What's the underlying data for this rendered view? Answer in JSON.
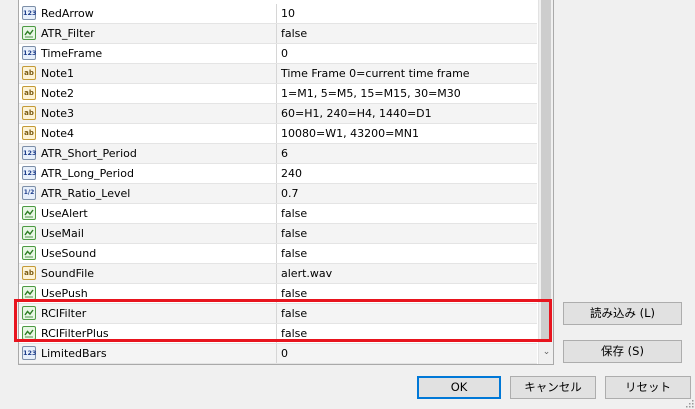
{
  "params": [
    {
      "type": "int",
      "icon": "int-type-icon",
      "name": "RedArrow",
      "value": "10"
    },
    {
      "type": "bool",
      "icon": "bool-type-icon",
      "name": "ATR_Filter",
      "value": "false"
    },
    {
      "type": "int",
      "icon": "int-type-icon",
      "name": "TimeFrame",
      "value": "0"
    },
    {
      "type": "str",
      "icon": "string-type-icon",
      "name": "Note1",
      "value": "Time Frame 0=current time frame"
    },
    {
      "type": "str",
      "icon": "string-type-icon",
      "name": "Note2",
      "value": "1=M1, 5=M5, 15=M15, 30=M30"
    },
    {
      "type": "str",
      "icon": "string-type-icon",
      "name": "Note3",
      "value": "60=H1, 240=H4, 1440=D1"
    },
    {
      "type": "str",
      "icon": "string-type-icon",
      "name": "Note4",
      "value": "10080=W1, 43200=MN1"
    },
    {
      "type": "int",
      "icon": "int-type-icon",
      "name": "ATR_Short_Period",
      "value": "6"
    },
    {
      "type": "int",
      "icon": "int-type-icon",
      "name": "ATR_Long_Period",
      "value": "240"
    },
    {
      "type": "dbl",
      "icon": "double-type-icon",
      "name": "ATR_Ratio_Level",
      "value": "0.7"
    },
    {
      "type": "bool",
      "icon": "bool-type-icon",
      "name": "UseAlert",
      "value": "false"
    },
    {
      "type": "bool",
      "icon": "bool-type-icon",
      "name": "UseMail",
      "value": "false"
    },
    {
      "type": "bool",
      "icon": "bool-type-icon",
      "name": "UseSound",
      "value": "false"
    },
    {
      "type": "str",
      "icon": "string-type-icon",
      "name": "SoundFile",
      "value": "alert.wav"
    },
    {
      "type": "bool",
      "icon": "bool-type-icon",
      "name": "UsePush",
      "value": "false"
    },
    {
      "type": "bool",
      "icon": "bool-type-icon",
      "name": "RCIFilter",
      "value": "false"
    },
    {
      "type": "bool",
      "icon": "bool-type-icon",
      "name": "RCIFilterPlus",
      "value": "false"
    },
    {
      "type": "int",
      "icon": "int-type-icon",
      "name": "LimitedBars",
      "value": "0"
    }
  ],
  "type_glyphs": {
    "int": "123",
    "dbl": "1/2",
    "str": "ab"
  },
  "buttons": {
    "load": "読み込み (L)",
    "save": "保存 (S)",
    "ok": "OK",
    "cancel": "キャンセル",
    "reset": "リセット"
  },
  "colors": {
    "highlight": "#e8141e",
    "primary_border": "#0078d7"
  }
}
